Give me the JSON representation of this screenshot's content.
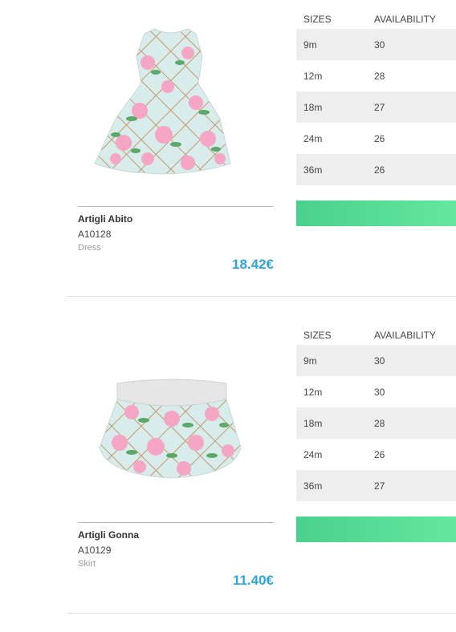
{
  "colors": {
    "price": "#2fa4dc",
    "add_bar_start": "#4bd18c",
    "add_bar_end": "#64e79f",
    "row_shade": "#eeeeee"
  },
  "products": [
    {
      "image_icon": "floral-dress-image",
      "name": "Artigli Abito",
      "code": "A10128",
      "category": "Dress",
      "price": "18.42€",
      "table_headers": {
        "size": "SIZES",
        "availability": "AVAILABILITY"
      },
      "sizes": [
        {
          "size": "9m",
          "availability": "30"
        },
        {
          "size": "12m",
          "availability": "28"
        },
        {
          "size": "18m",
          "availability": "27"
        },
        {
          "size": "24m",
          "availability": "26"
        },
        {
          "size": "36m",
          "availability": "26"
        }
      ]
    },
    {
      "image_icon": "floral-skirt-image",
      "name": "Artigli Gonna",
      "code": "A10129",
      "category": "Skirt",
      "price": "11.40€",
      "table_headers": {
        "size": "SIZES",
        "availability": "AVAILABILITY"
      },
      "sizes": [
        {
          "size": "9m",
          "availability": "30"
        },
        {
          "size": "12m",
          "availability": "30"
        },
        {
          "size": "18m",
          "availability": "28"
        },
        {
          "size": "24m",
          "availability": "26"
        },
        {
          "size": "36m",
          "availability": "27"
        }
      ]
    }
  ]
}
